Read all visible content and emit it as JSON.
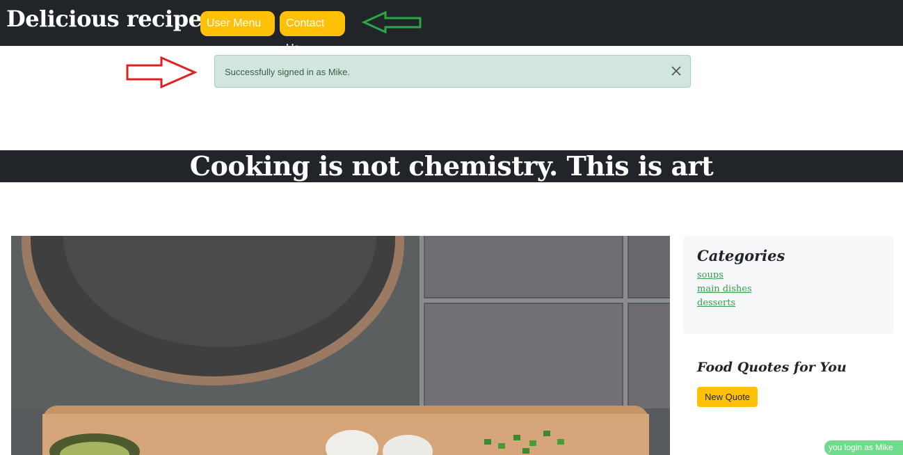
{
  "navbar": {
    "brand": "Delicious recipes",
    "user_menu_label": "User Menu",
    "contact_label": "Contact Us"
  },
  "alert": {
    "message": "Successfully signed in as Mike."
  },
  "banner": {
    "text": "Cooking is not chemistry. This is art"
  },
  "sidebar": {
    "categories_title": "Categories",
    "categories": [
      "soups",
      "main dishes",
      "desserts"
    ]
  },
  "quotes": {
    "title": "Food Quotes for You",
    "button_label": "New Quote"
  },
  "status": {
    "login_text": "you login as Mike"
  },
  "colors": {
    "navbar_bg": "#212529",
    "button_accent": "#ffc107",
    "alert_bg": "#d1e7dd",
    "link_green": "#3a9a4a",
    "annotation_red": "#e02020",
    "annotation_green": "#2aa845"
  }
}
